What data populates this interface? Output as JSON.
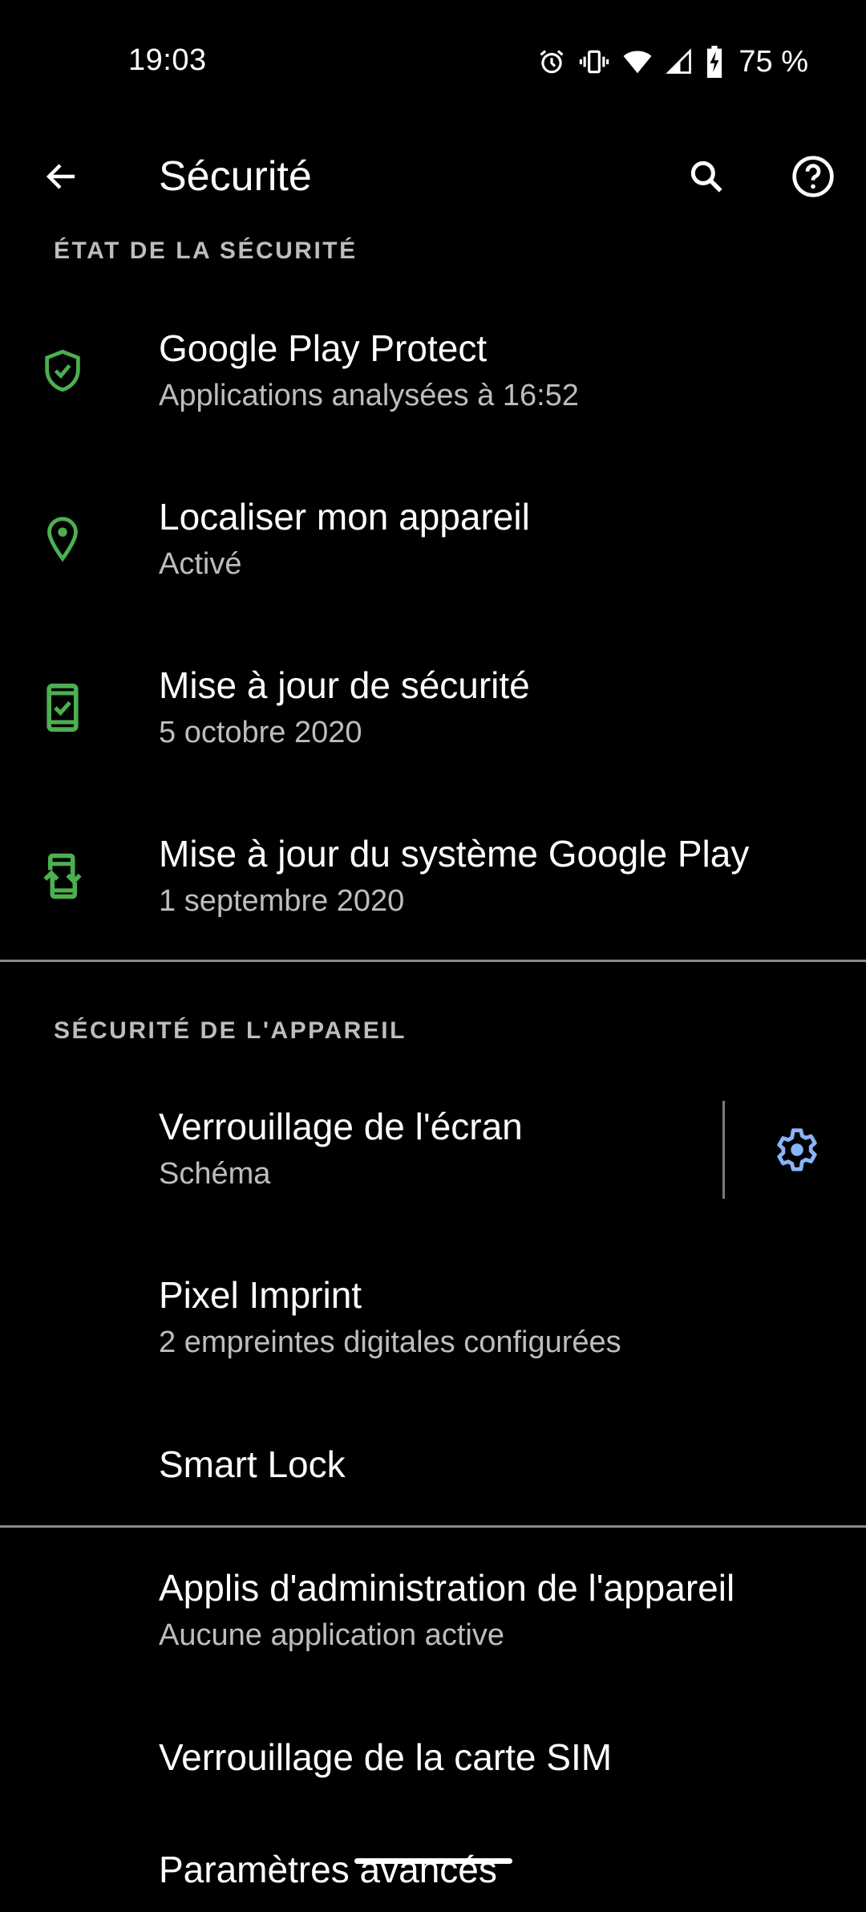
{
  "status_bar": {
    "time": "19:03",
    "icons": [
      "alarm-icon",
      "vibrate-icon",
      "wifi-icon",
      "cell-signal-icon",
      "battery-charging-icon"
    ],
    "battery_percent": "75 %"
  },
  "app_bar": {
    "title": "Sécurité",
    "back_icon": "arrow-back-icon",
    "search_icon": "search-icon",
    "help_icon": "help-icon"
  },
  "colors": {
    "status_icon_green": "#4caf50",
    "accent_blue": "#8ab4f8",
    "secondary_text": "#bdbdbd",
    "background": "#000000"
  },
  "sections": [
    {
      "header": "ÉTAT DE LA SÉCURITÉ",
      "items": [
        {
          "title": "Google Play Protect",
          "subtitle": "Applications analysées à 16:52",
          "icon": "shield-check-icon"
        },
        {
          "title": "Localiser mon appareil",
          "subtitle": "Activé",
          "icon": "location-pin-icon"
        },
        {
          "title": "Mise à jour de sécurité",
          "subtitle": "5 octobre 2020",
          "icon": "phone-check-icon"
        },
        {
          "title": "Mise à jour du système Google Play",
          "subtitle": "1 septembre 2020",
          "icon": "phone-sync-icon"
        }
      ]
    },
    {
      "header": "SÉCURITÉ DE L'APPAREIL",
      "items": [
        {
          "title": "Verrouillage de l'écran",
          "subtitle": "Schéma",
          "action_icon": "gear-icon"
        },
        {
          "title": "Pixel Imprint",
          "subtitle": "2 empreintes digitales configurées"
        },
        {
          "title": "Smart Lock"
        }
      ]
    },
    {
      "items": [
        {
          "title": "Applis d'administration de l'appareil",
          "subtitle": "Aucune application active"
        },
        {
          "title": "Verrouillage de la carte SIM"
        },
        {
          "title": "Paramètres avancés"
        }
      ]
    }
  ]
}
